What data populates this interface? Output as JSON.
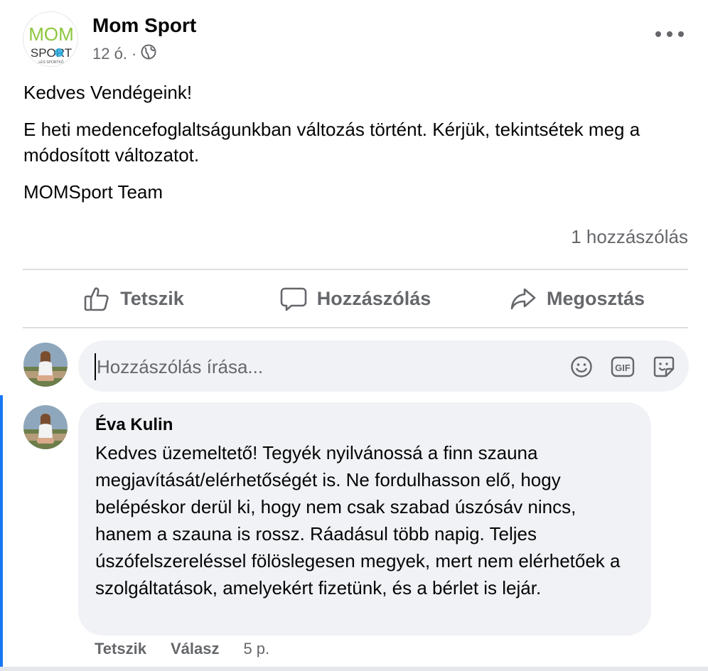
{
  "page": {
    "name": "Mom Sport",
    "logo_text_top": "MOM",
    "logo_text_bottom": "SPORT",
    "logo_tagline": "...LÉS SPORTKÖ...",
    "time": "12 ó.",
    "separator": "·",
    "audience_icon": "globe-icon"
  },
  "post": {
    "paragraphs": [
      "Kedves Vendégeink!",
      "E heti medencefoglaltságunkban változás történt. Kérjük, tekintsétek meg a módosított változatot.",
      "MOMSport Team"
    ],
    "comment_count": "1 hozzászólás"
  },
  "actions": {
    "like": {
      "label": "Tetszik",
      "icon": "thumbs-up-icon"
    },
    "comment": {
      "label": "Hozzászólás",
      "icon": "speech-bubble-icon"
    },
    "share": {
      "label": "Megosztás",
      "icon": "share-arrow-icon"
    }
  },
  "composer": {
    "placeholder": "Hozzászólás írása...",
    "value": "",
    "icons": [
      "emoji-icon",
      "gif-icon",
      "sticker-icon"
    ],
    "gif_label": "GIF"
  },
  "comments": [
    {
      "author": "Éva Kulin",
      "text": "Kedves üzemeltető! Tegyék nyilvánossá a finn szauna megjavítását/elérhetőségét is. Ne fordulhasson elő, hogy belépéskor derül ki, hogy nem csak szabad úszósáv nincs, hanem a szauna is rossz. Ráadásul több napig. Teljes úszófelszereléssel fölöslegesen megyek, mert nem elérhetőek a szolgáltatások, amelyekért fizetünk, és a bérlet is lejár.",
      "like_label": "Tetszik",
      "reply_label": "Válasz",
      "time": "5 p."
    }
  ],
  "colors": {
    "accent": "#1877f2",
    "secondary_text": "#65676b",
    "bubble": "#f0f2f5",
    "logo_green": "#8dc63f",
    "logo_blue": "#29a9e0"
  }
}
